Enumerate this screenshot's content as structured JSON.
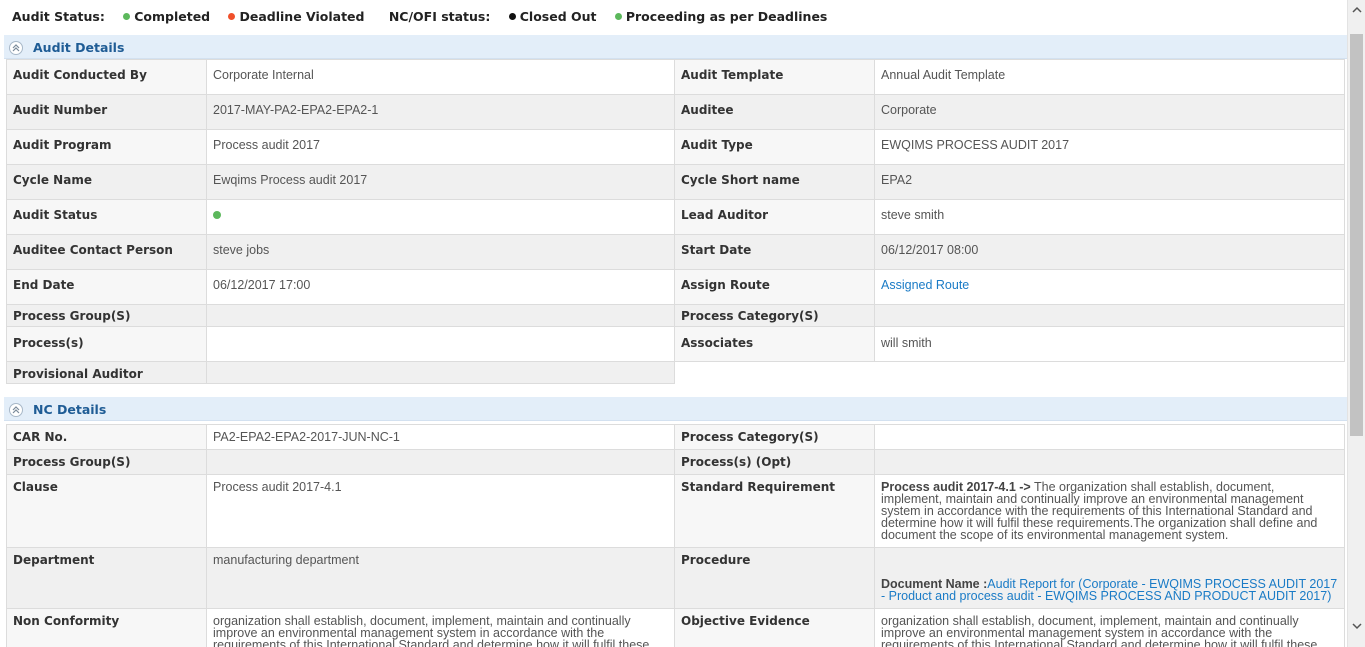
{
  "status_legend": {
    "audit_status_label": "Audit Status:",
    "audit_items": [
      {
        "label": "Completed",
        "color": "#5cb85c"
      },
      {
        "label": "Deadline Violated",
        "color": "#f0502a"
      }
    ],
    "ncofi_label": "NC/OFI status:",
    "ncofi_items": [
      {
        "label": "Closed Out",
        "color": "#111111"
      },
      {
        "label": "Proceeding as per Deadlines",
        "color": "#5cb85c"
      }
    ]
  },
  "audit_details": {
    "title": "Audit Details",
    "rows": [
      {
        "k1": "Audit Conducted By",
        "v1": "Corporate Internal",
        "k2": "Audit Template",
        "v2": "Annual Audit Template"
      },
      {
        "k1": "Audit Number",
        "v1": "2017-MAY-PA2-EPA2-EPA2-1",
        "k2": "Auditee",
        "v2": "Corporate"
      },
      {
        "k1": "Audit Program",
        "v1": "Process audit 2017",
        "k2": "Audit Type",
        "v2": "EWQIMS PROCESS AUDIT 2017"
      },
      {
        "k1": "Cycle Name",
        "v1": "Ewqims Process audit 2017",
        "k2": "Cycle Short name",
        "v2": "EPA2"
      },
      {
        "k1": "Audit Status",
        "v1": "",
        "k2": "Lead Auditor",
        "v2": "steve smith"
      },
      {
        "k1": "Auditee Contact Person",
        "v1": "steve jobs",
        "k2": "Start Date",
        "v2": "06/12/2017 08:00"
      },
      {
        "k1": "End Date",
        "v1": "06/12/2017 17:00",
        "k2": "Assign Route",
        "v2": "Assigned Route"
      },
      {
        "k1": "Process Group(S)",
        "v1": "",
        "k2": "Process Category(S)",
        "v2": ""
      },
      {
        "k1": "Process(s)",
        "v1": "",
        "k2": "Associates",
        "v2": "will smith"
      },
      {
        "k1": "Provisional Auditor",
        "v1": ""
      }
    ],
    "audit_status_dot_color": "#5cb85c"
  },
  "nc_details": {
    "title": "NC Details",
    "car_no_label": "CAR No.",
    "car_no": "PA2-EPA2-EPA2-2017-JUN-NC-1",
    "process_category_label": "Process Category(S)",
    "process_category": "",
    "process_group_label": "Process Group(S)",
    "process_group": "",
    "process_opt_label": "Process(s) (Opt)",
    "process_opt": "",
    "clause_label": "Clause",
    "clause": "Process audit 2017-4.1",
    "std_req_label": "Standard Requirement",
    "std_req_prefix": "Process audit 2017-4.1 ->",
    "std_req_text": " The organization shall establish, document, implement, maintain and continually improve an environmental management system in accordance with the requirements of this International Standard and determine how it will fulfil these requirements.The organization shall define and document the scope of its environmental management system.",
    "department_label": "Department",
    "department": "manufacturing department",
    "procedure_label": "Procedure",
    "doc_name_label": "Document Name :",
    "doc_name_link": "Audit Report for (Corporate - EWQIMS PROCESS AUDIT 2017 - Product and process audit - EWQIMS PROCESS AND PRODUCT AUDIT 2017)",
    "non_conformity_label": "Non Conformity",
    "non_conformity": "organization shall establish, document, implement, maintain and continually improve an environmental management system in accordance with the requirements of this International Standard and determine how it will fulfil these requirements.The",
    "objective_evidence_label": "Objective Evidence",
    "objective_evidence": "organization shall establish, document, implement, maintain and continually improve an environmental management system in accordance with the requirements of this International Standard and determine how it will fulfil these requirements.The"
  }
}
